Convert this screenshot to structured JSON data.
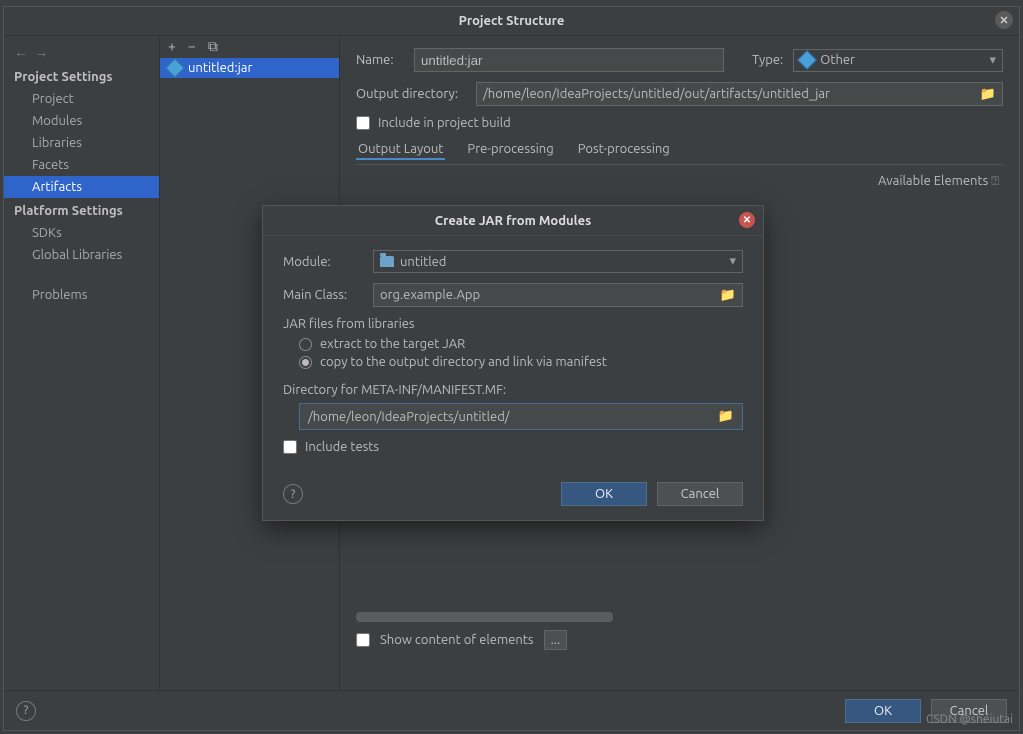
{
  "window": {
    "title": "Project Structure"
  },
  "sidebar": {
    "sections": [
      {
        "header": "Project Settings",
        "items": [
          {
            "label": "Project"
          },
          {
            "label": "Modules"
          },
          {
            "label": "Libraries"
          },
          {
            "label": "Facets"
          },
          {
            "label": "Artifacts",
            "selected": true
          }
        ]
      },
      {
        "header": "Platform Settings",
        "items": [
          {
            "label": "SDKs"
          },
          {
            "label": "Global Libraries"
          }
        ]
      },
      {
        "header": "",
        "items": [
          {
            "label": "Problems"
          }
        ]
      }
    ]
  },
  "artifacts_list": {
    "items": [
      {
        "label": "untitled:jar"
      }
    ]
  },
  "panel": {
    "name_label": "Name:",
    "name_value": "untitled:jar",
    "type_label": "Type:",
    "type_value": "Other",
    "outdir_label": "Output directory:",
    "outdir_value": "/home/leon/IdeaProjects/untitled/out/artifacts/untitled_jar",
    "include_build": "Include in project build",
    "tabs": [
      "Output Layout",
      "Pre-processing",
      "Post-processing"
    ],
    "available_elements": "Available Elements",
    "show_content": "Show content of elements",
    "ellipsis": "..."
  },
  "modal": {
    "title": "Create JAR from Modules",
    "module_label": "Module:",
    "module_value": "untitled",
    "main_class_label": "Main Class:",
    "main_class_value": "org.example.App",
    "jar_files_label": "JAR files from libraries",
    "radio_extract": "extract to the target JAR",
    "radio_copy": "copy to the output directory and link via manifest",
    "dir_label": "Directory for META-INF/MANIFEST.MF:",
    "dir_value": "/home/leon/IdeaProjects/untitled/",
    "include_tests": "Include tests",
    "ok": "OK",
    "cancel": "Cancel"
  },
  "footer": {
    "ok": "OK",
    "cancel": "Cancel"
  },
  "watermark": "CSDN @sheiutai"
}
